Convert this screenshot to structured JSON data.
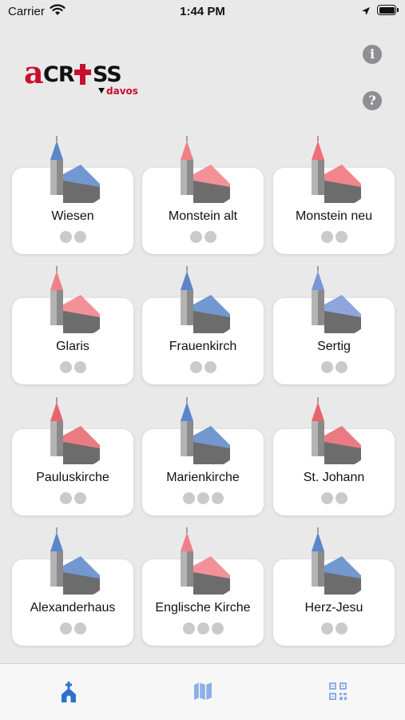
{
  "status_bar": {
    "carrier": "Carrier",
    "time": "1:44 PM"
  },
  "header": {
    "logo_main": "aCROSS",
    "logo_sub": "davos",
    "info_button": "i",
    "help_button": "?"
  },
  "churches": [
    {
      "name": "Wiesen",
      "dots": 2,
      "accent": "#5b86c8"
    },
    {
      "name": "Monstein alt",
      "dots": 2,
      "accent": "#f07f86"
    },
    {
      "name": "Monstein neu",
      "dots": 2,
      "accent": "#f06f78"
    },
    {
      "name": "Glaris",
      "dots": 2,
      "accent": "#f07f86"
    },
    {
      "name": "Frauenkirch",
      "dots": 2,
      "accent": "#5b86c8"
    },
    {
      "name": "Sertig",
      "dots": 2,
      "accent": "#7a96d6"
    },
    {
      "name": "Pauluskirche",
      "dots": 2,
      "accent": "#e8646c"
    },
    {
      "name": "Marienkirche",
      "dots": 3,
      "accent": "#5b86c8"
    },
    {
      "name": "St. Johann",
      "dots": 2,
      "accent": "#e8646c"
    },
    {
      "name": "Alexanderhaus",
      "dots": 2,
      "accent": "#5b86c8"
    },
    {
      "name": "Englische Kirche",
      "dots": 3,
      "accent": "#f07f86"
    },
    {
      "name": "Herz-Jesu",
      "dots": 2,
      "accent": "#5b86c8"
    }
  ],
  "tabbar": {
    "tabs": [
      {
        "icon": "church-icon",
        "active": true
      },
      {
        "icon": "map-icon",
        "active": false
      },
      {
        "icon": "qr-code-icon",
        "active": false
      }
    ],
    "active_color": "#2f6fd0",
    "inactive_color": "#8ab0e6"
  }
}
